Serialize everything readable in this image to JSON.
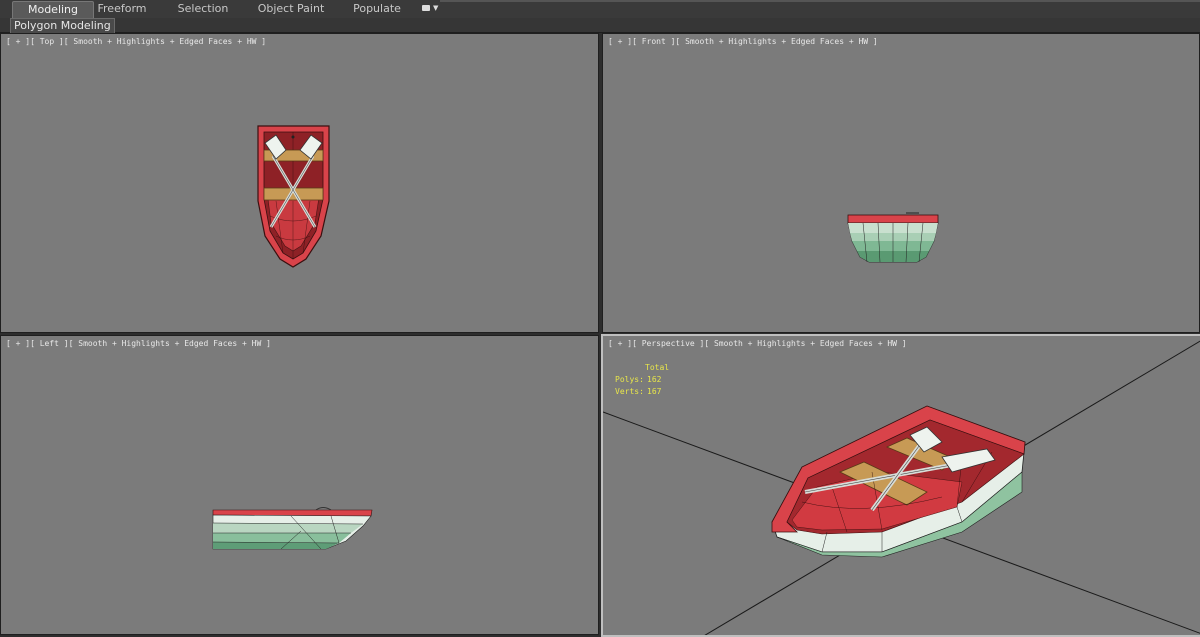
{
  "ribbon": {
    "tabs": [
      {
        "label": "Modeling",
        "active": true
      },
      {
        "label": "Freeform",
        "active": false
      },
      {
        "label": "Selection",
        "active": false
      },
      {
        "label": "Object Paint",
        "active": false
      },
      {
        "label": "Populate",
        "active": false
      }
    ],
    "extra_icon": "dropdown-toggle-icon",
    "panel_label": "Polygon Modeling"
  },
  "viewports": {
    "top": {
      "label": "[ + ][ Top ][ Smooth + Highlights + Edged Faces + HW ]"
    },
    "front": {
      "label": "[ + ][ Front ][ Smooth + Highlights + Edged Faces + HW ]"
    },
    "left": {
      "label": "[ + ][ Left ][ Smooth + Highlights + Edged Faces + HW ]"
    },
    "perspective": {
      "label": "[ + ][ Perspective ][ Smooth + Highlights + Edged Faces + HW ]",
      "stats": {
        "header": "Total",
        "polys_label": "Polys:",
        "polys_value": "162",
        "verts_label": "Verts:",
        "verts_value": "167"
      }
    }
  },
  "colors": {
    "viewport_bg": "#7b7b7b",
    "boat_red": "#d9434a",
    "boat_white": "#e6efe8",
    "wood": "#c79a55",
    "stats_yellow": "#e8e64a"
  }
}
